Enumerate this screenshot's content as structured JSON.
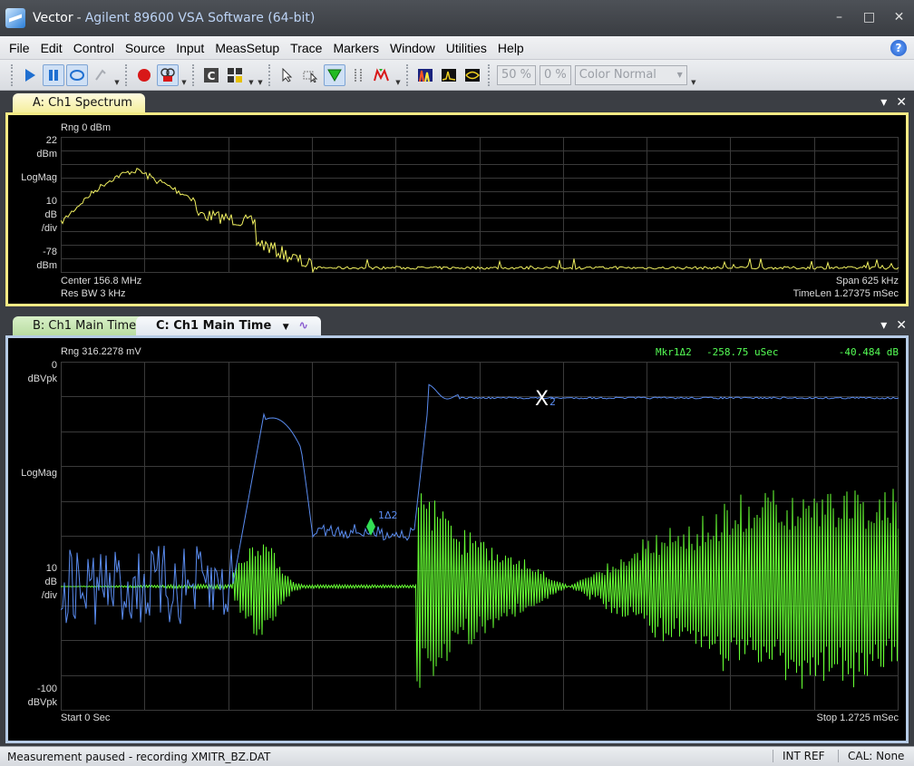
{
  "window": {
    "app_name": "Vector",
    "separator": "-",
    "product": "Agilent 89600 VSA Software (64-bit)",
    "minimize": "–",
    "maximize": "□",
    "close": "✕"
  },
  "menu": [
    "File",
    "Edit",
    "Control",
    "Source",
    "Input",
    "MeasSetup",
    "Trace",
    "Markers",
    "Window",
    "Utilities",
    "Help"
  ],
  "toolbar": {
    "percent1": "50 %",
    "percent2": "0 %",
    "color_mode": "Color Normal",
    "c_label": "C"
  },
  "panel_a": {
    "tab_label": "A: Ch1 Spectrum",
    "range": "Rng 0 dBm",
    "y_top_value": "22",
    "y_top_unit": "dBm",
    "format": "LogMag",
    "scale_value": "10",
    "scale_unit1": "dB",
    "scale_unit2": "/div",
    "y_bottom_value": "-78",
    "y_bottom_unit": "dBm",
    "center": "Center 156.8 MHz",
    "res_bw": "Res BW 3 kHz",
    "span": "Span 625 kHz",
    "timelen": "TimeLen 1.27375 mSec",
    "trace_color": "#f0f060"
  },
  "panel_c": {
    "tab_b_label": "B: Ch1 Main Time",
    "tab_c_label": "C: Ch1 Main Time",
    "range": "Rng 316.2278 mV",
    "marker_label": "Mkr1Δ2",
    "marker_time": "-258.75 uSec",
    "marker_value": "-40.484 dB",
    "y_top_value": "0",
    "y_top_unit": "dBVpk",
    "format": "LogMag",
    "scale_value": "10",
    "scale_unit1": "dB",
    "scale_unit2": "/div",
    "y_bottom_value": "-100",
    "y_bottom_unit": "dBVpk",
    "start": "Start 0  Sec",
    "stop": "Stop 1.2725 mSec",
    "marker1_text": "1Δ2",
    "marker2_text": "X",
    "marker2_sub": "2",
    "trace1_color": "#5a8cf0",
    "trace2_color": "#66ff33"
  },
  "status": {
    "message": "Measurement paused - recording XMITR_BZ.DAT",
    "ref": "INT REF",
    "cal": "CAL: None"
  }
}
